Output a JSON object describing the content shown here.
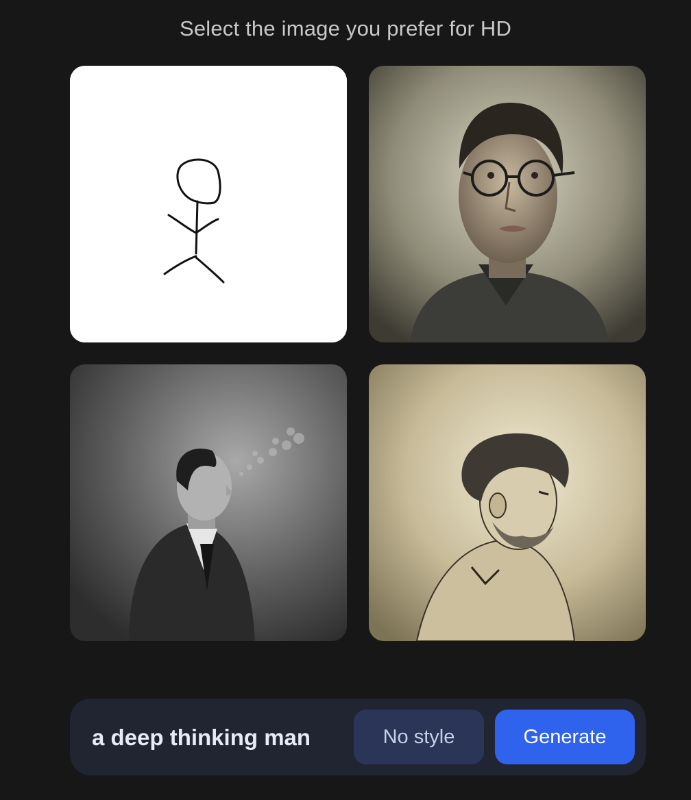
{
  "header": {
    "title": "Select the image you prefer for HD"
  },
  "images": [
    {
      "id": "stick-figure-sketch"
    },
    {
      "id": "man-with-glasses-portrait"
    },
    {
      "id": "man-in-suit-profile"
    },
    {
      "id": "bearded-man-illustration"
    }
  ],
  "prompt": {
    "value": "a deep thinking man",
    "style_label": "No style",
    "generate_label": "Generate"
  },
  "colors": {
    "background": "#171717",
    "bar": "#212431",
    "style_button": "#2a3558",
    "generate_button": "#2f63ee"
  }
}
